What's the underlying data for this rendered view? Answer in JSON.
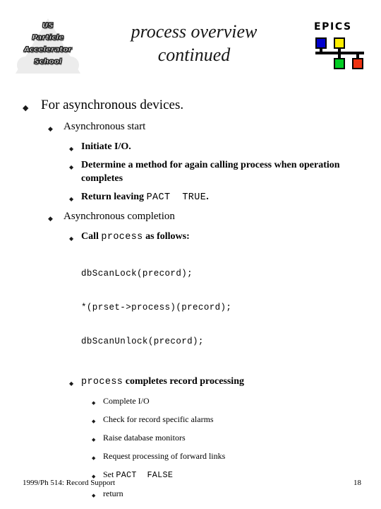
{
  "slide": {
    "title_line1": "process overview",
    "title_line2": "continued",
    "bullet_glyph": "◆"
  },
  "logo_uspas": {
    "line1": "US",
    "line2": "Particle",
    "line3": "Accelerator",
    "line4": "School",
    "triangle_color": "#ececec"
  },
  "logo_epics": {
    "wordmark": "EPICS",
    "square_colors": {
      "blue": "#0000cc",
      "yellow": "#ffee00",
      "green": "#00cc22",
      "red": "#ee3311"
    }
  },
  "outline": {
    "l1_for_async_devices": "For asynchronous devices.",
    "l2_async_start": "Asynchronous start",
    "l3_initiate_io": "Initiate I/O.",
    "l3_determine_method": "Determine a method for again calling process when operation completes",
    "l3_return_leaving_prefix": "Return leaving ",
    "l3_return_leaving_code": "PACT  TRUE",
    "l3_return_leaving_suffix": ".",
    "l2_async_completion": "Asynchronous completion",
    "l3_call_prefix": "Call ",
    "l3_call_code": "process",
    "l3_call_suffix": " as follows:",
    "code_line1": "dbScanLock(precord);",
    "code_line2": "*(prset->process)(precord);",
    "code_line3": "dbScanUnlock(precord);",
    "l3_process_completes_code": "process",
    "l3_process_completes_text": " completes record processing",
    "l4_complete_io": "Complete I/O",
    "l4_check_alarms": "Check for record specific alarms",
    "l4_raise_monitors": "Raise database monitors",
    "l4_forward_links": "Request processing of forward links",
    "l4_set_pact_prefix": "Set ",
    "l4_set_pact_code": "PACT  FALSE",
    "l4_return": "return"
  },
  "footer": {
    "left": "1999/Ph 514: Record Support",
    "page_number": "18"
  }
}
